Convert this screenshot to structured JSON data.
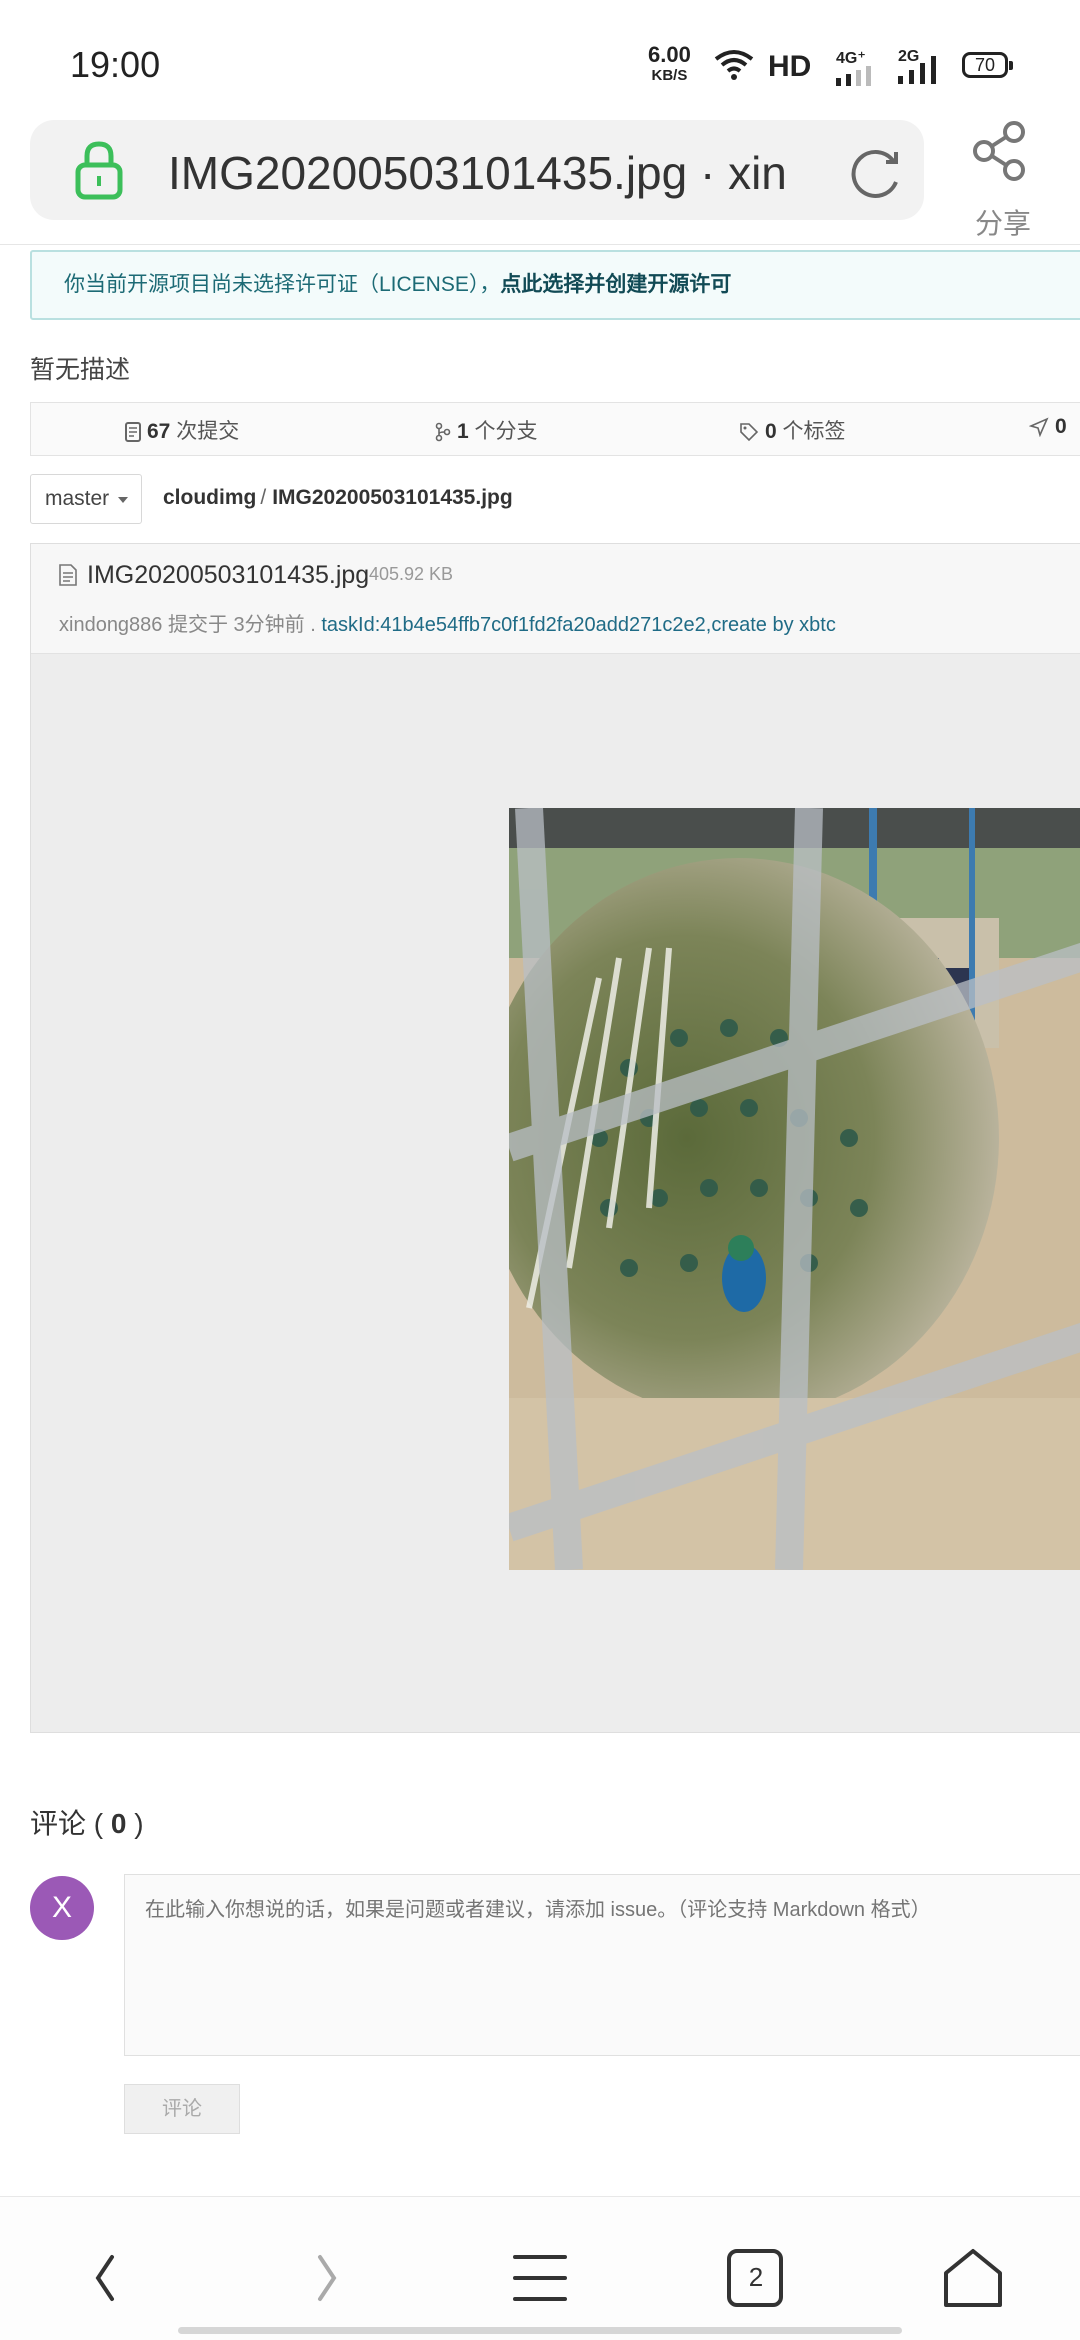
{
  "status_bar": {
    "time": "19:00",
    "net_speed_value": "6.00",
    "net_speed_unit": "KB/S",
    "hd": "HD",
    "g4": "4G⁺",
    "g2": "2G",
    "battery": "70"
  },
  "browser": {
    "url_title": "IMG20200503101435.jpg · xin",
    "share_label": "分享",
    "tab_count": "2"
  },
  "license_notice": {
    "text": "你当前开源项目尚未选择许可证（LICENSE），",
    "link": "点此选择并创建开源许可"
  },
  "repo": {
    "description": "暂无描述",
    "stats": {
      "commits_count": "67",
      "commits_label": "次提交",
      "branches_count": "1",
      "branches_label": "个分支",
      "tags_count": "0",
      "tags_label": "个标签",
      "releases_count": "0"
    },
    "branch": "master",
    "breadcrumb_root": "cloudimg",
    "breadcrumb_sep": "/",
    "breadcrumb_file": "IMG20200503101435.jpg"
  },
  "file": {
    "name": "IMG20200503101435.jpg",
    "size": "405.92 KB",
    "commit_author": "xindong886",
    "commit_time": "提交于 3分钟前 .",
    "commit_message": "taskId:41b4e54ffb7c0f1fd2fa20add271c2e2,create by xbtc"
  },
  "comments": {
    "title_prefix": "评论 ( ",
    "count": "0",
    "title_suffix": " )",
    "avatar_letter": "X",
    "placeholder": "在此输入你想说的话，如果是问题或者建议，请添加 issue。（评论支持 Markdown 格式）",
    "submit_label": "评论"
  }
}
